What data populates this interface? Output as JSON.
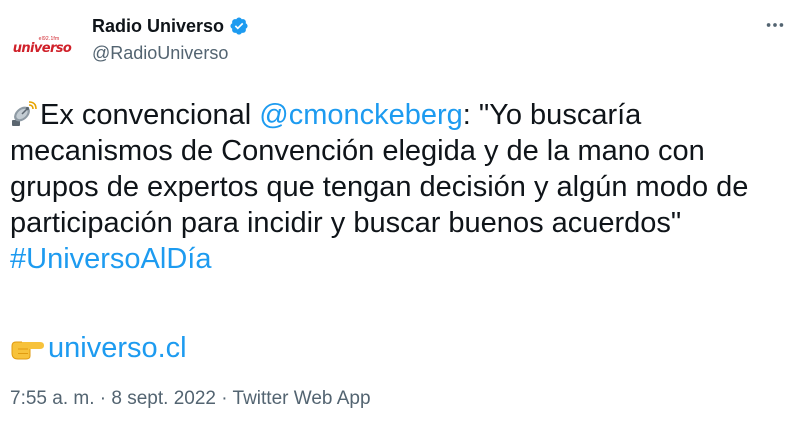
{
  "author": {
    "logo_small_text": "el92.1fm",
    "logo_text": "universo",
    "display_name": "Radio Universo",
    "handle": "@RadioUniverso",
    "verified_icon": "verified-badge-icon"
  },
  "menu": {
    "more_icon": "more-horizontal-icon"
  },
  "tweet": {
    "emoji_satellite": "satellite-antenna-icon",
    "text_prefix": "Ex convencional ",
    "mention": "@cmonckeberg",
    "text_quote": ": \"Yo buscaría mecanismos de Convención elegida y de la mano con grupos de expertos que tengan decisión y algún modo de participación para incidir y buscar buenos acuerdos\" ",
    "hashtag": "#UniversoAlDía",
    "emoji_pointing": "backhand-index-pointing-right-icon",
    "link_text": "universo.cl"
  },
  "meta": {
    "time": "7:55 a. m.",
    "separator": " · ",
    "date": "8 sept. 2022",
    "source": "Twitter Web App"
  },
  "colors": {
    "link": "#1d9bf0",
    "text": "#0f1419",
    "secondary": "#536471",
    "brand": "#d0212a"
  }
}
